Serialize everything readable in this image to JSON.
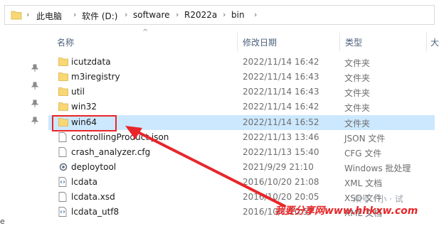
{
  "breadcrumb": {
    "items": [
      "此电脑",
      "软件 (D:)",
      "software",
      "R2022a",
      "bin"
    ]
  },
  "columns": {
    "name": "名称",
    "date": "修改日期",
    "type": "类型",
    "size_partial": "大"
  },
  "files": [
    {
      "name": "icutzdata",
      "date": "2022/11/14 16:42",
      "type": "文件夹",
      "icon": "folder-icon"
    },
    {
      "name": "m3iregistry",
      "date": "2022/11/14 16:43",
      "type": "文件夹",
      "icon": "folder-icon"
    },
    {
      "name": "util",
      "date": "2022/11/14 16:43",
      "type": "文件夹",
      "icon": "folder-icon"
    },
    {
      "name": "win32",
      "date": "2022/11/14 16:42",
      "type": "文件夹",
      "icon": "folder-icon"
    },
    {
      "name": "win64",
      "date": "2022/11/14 16:52",
      "type": "文件夹",
      "icon": "folder-icon",
      "selected": true
    },
    {
      "name": "controllingProduct.json",
      "date": "2022/11/13 13:46",
      "type": "JSON 文件",
      "icon": "file-icon"
    },
    {
      "name": "crash_analyzer.cfg",
      "date": "2022/11/13 15:40",
      "type": "CFG 文件",
      "icon": "file-icon"
    },
    {
      "name": "deploytool",
      "date": "2021/9/29 21:10",
      "type": "Windows 批处理",
      "icon": "batch-icon"
    },
    {
      "name": "lcdata",
      "date": "2016/10/20 21:08",
      "type": "XML 文档",
      "icon": "xml-icon"
    },
    {
      "name": "lcdata.xsd",
      "date": "2016/10/20 20:05",
      "type": "XSD 文件",
      "icon": "file-icon"
    },
    {
      "name": "lcdata_utf8",
      "date": "2016/10/1 10:57",
      "type": "XML 文档",
      "icon": "xml-icon"
    }
  ],
  "watermark": {
    "text": "我要分享网www.hhkxw.com",
    "back_text": "众号 · 小 · 试"
  },
  "colors": {
    "selection": "#cce8ff",
    "annotation": "#e8262a",
    "folder": "#f8d775"
  }
}
